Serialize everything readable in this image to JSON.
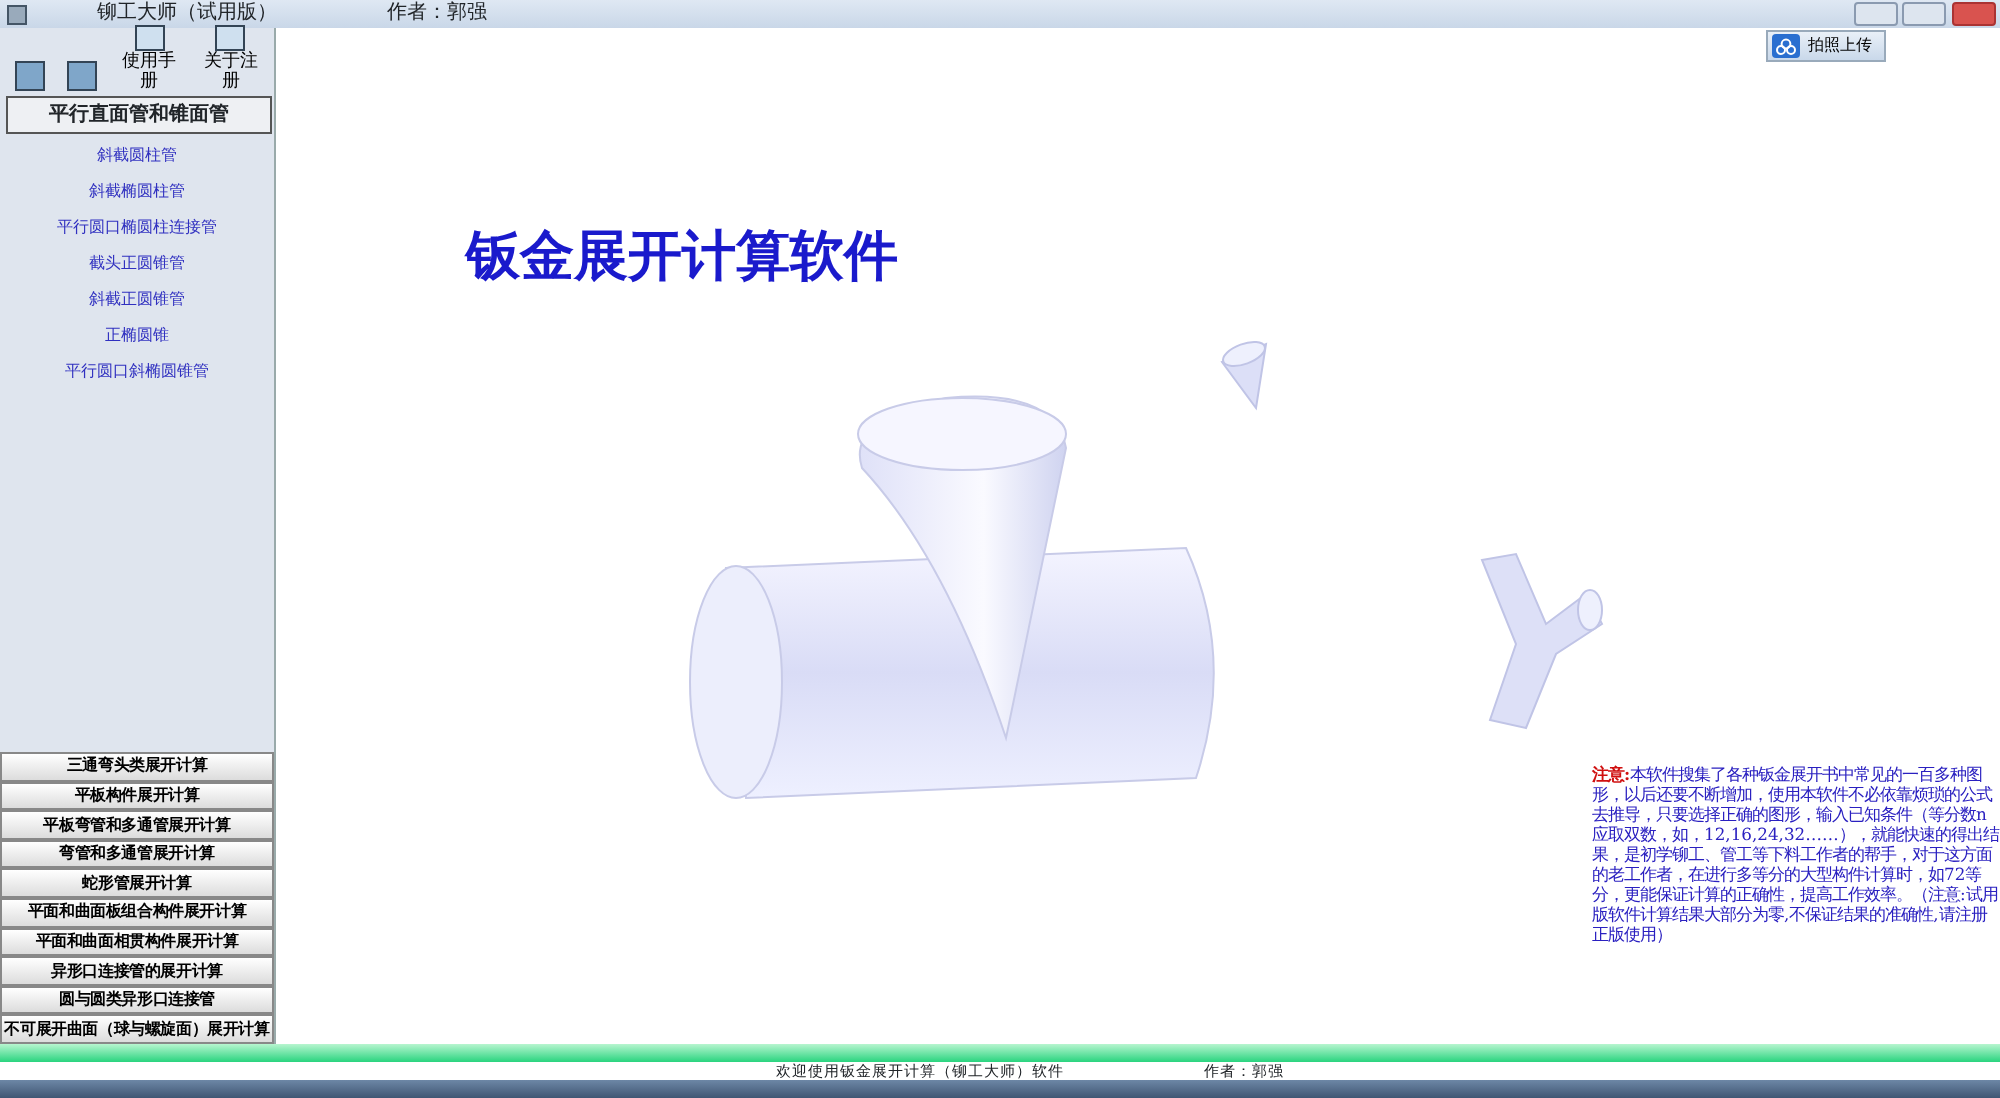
{
  "window": {
    "title": "铆工大师（试用版）",
    "author": "作者：郭强"
  },
  "toolbar": {
    "items": [
      {
        "label": "使用手册"
      },
      {
        "label": "关于注册"
      }
    ]
  },
  "upload_button": {
    "label": "拍照上传"
  },
  "sidebar": {
    "header": "平行直面管和锥面管",
    "items": [
      {
        "label": "斜截圆柱管"
      },
      {
        "label": "斜截椭圆柱管"
      },
      {
        "label": "平行圆口椭圆柱连接管"
      },
      {
        "label": "截头正圆锥管"
      },
      {
        "label": "斜截正圆锥管"
      },
      {
        "label": "正椭圆锥"
      },
      {
        "label": "平行圆口斜椭圆锥管"
      }
    ],
    "categories": [
      {
        "label": "三通弯头类展开计算"
      },
      {
        "label": "平板构件展开计算"
      },
      {
        "label": "平板弯管和多通管展开计算"
      },
      {
        "label": "弯管和多通管展开计算"
      },
      {
        "label": "蛇形管展开计算"
      },
      {
        "label": "平面和曲面板组合构件展开计算"
      },
      {
        "label": "平面和曲面相贯构件展开计算"
      },
      {
        "label": "异形口连接管的展开计算"
      },
      {
        "label": "圆与圆类异形口连接管"
      },
      {
        "label": "不可展开曲面（球与螺旋面）展开计算"
      }
    ]
  },
  "main": {
    "title": "钣金展开计算软件",
    "note_label": "注意:",
    "note": "本软件搜集了各种钣金展开书中常见的一百多种图形，以后还要不断增加，使用本软件不必依靠烦琐的公式去推导，只要选择正确的图形，输入已知条件（等分数n应取双数，如，12,16,24,32……），就能快速的得出结果，是初学铆工、管工等下料工作者的帮手，对于这方面的老工作者，在进行多等分的大型构件计算时，如72等分，更能保证计算的正确性，提高工作效率。（注意:试用版软件计算结果大部分为零,不保证结果的准确性,请注册正版使用）"
  },
  "status_bar": {
    "message": "欢迎使用钣金展开计算（铆工大师）软件",
    "author": "作者：郭强"
  }
}
